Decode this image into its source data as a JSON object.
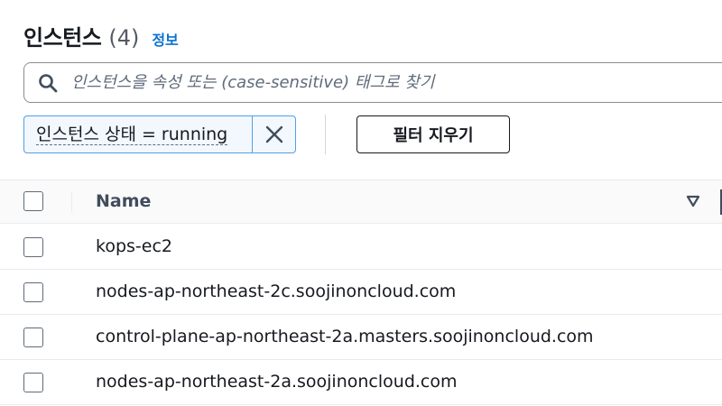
{
  "header": {
    "title": "인스턴스",
    "count": "(4)",
    "info_link": "정보"
  },
  "search": {
    "placeholder": "인스턴스을 속성 또는 (case-sensitive) 태그로 찾기",
    "value": ""
  },
  "filter": {
    "token_label": "인스턴스 상태 = running",
    "clear_label": "필터 지우기"
  },
  "table": {
    "columns": [
      "Name"
    ],
    "rows": [
      {
        "name": "kops-ec2"
      },
      {
        "name": "nodes-ap-northeast-2c.soojinoncloud.com"
      },
      {
        "name": "control-plane-ap-northeast-2a.masters.soojinoncloud.com"
      },
      {
        "name": "nodes-ap-northeast-2a.soojinoncloud.com"
      }
    ]
  },
  "icons": {
    "search": "search-icon",
    "remove_token": "close-icon",
    "sort": "sort-descending-icon",
    "checkbox": "checkbox-icon"
  },
  "colors": {
    "link": "#0972d3",
    "token_border": "#539fe5",
    "token_bg": "#f2f8fd",
    "text": "#16191f",
    "header_text": "#414d5c"
  }
}
